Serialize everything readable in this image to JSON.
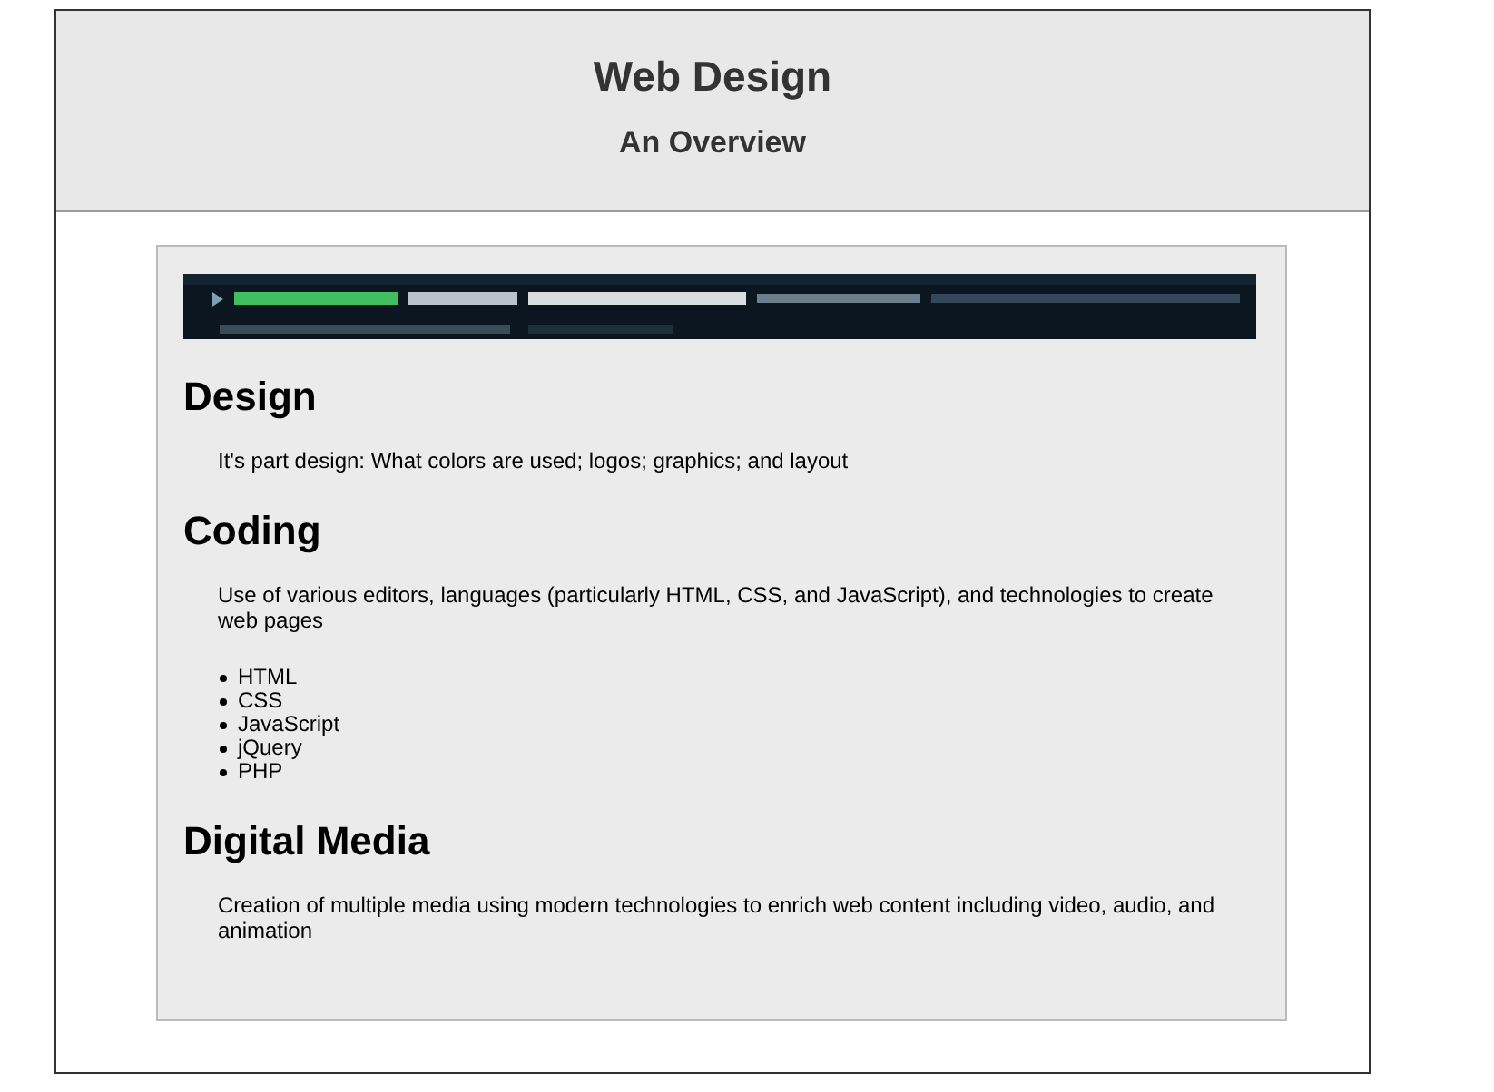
{
  "header": {
    "title": "Web Design",
    "subtitle": "An Overview"
  },
  "sections": [
    {
      "heading": "Design",
      "paragraph": "It's part design: What colors are used; logos; graphics; and layout"
    },
    {
      "heading": "Coding",
      "paragraph": "Use of various editors, languages (particularly HTML, CSS, and JavaScript), and technologies to create web pages",
      "list": [
        "HTML",
        "CSS",
        "JavaScript",
        "jQuery",
        "PHP"
      ]
    },
    {
      "heading": "Digital Media",
      "paragraph": "Creation of multiple media using modern technologies to enrich web content including video, audio, and animation"
    }
  ]
}
